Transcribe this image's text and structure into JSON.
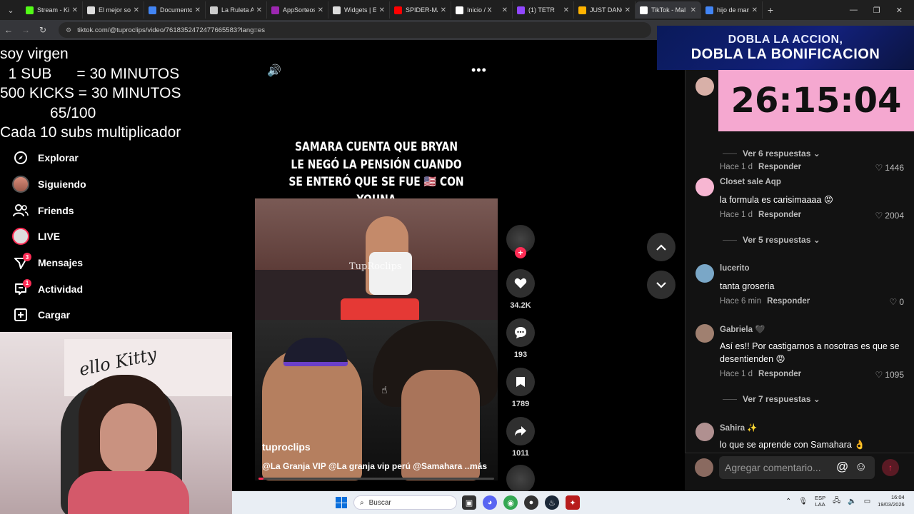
{
  "browser": {
    "tabs": [
      {
        "title": "Stream - Kick",
        "color": "#53fc18"
      },
      {
        "title": "El mejor soft",
        "color": "#dddddd"
      },
      {
        "title": "Documento",
        "color": "#4285f4"
      },
      {
        "title": "La Ruleta Ale",
        "color": "#cccccc"
      },
      {
        "title": "AppSorteos",
        "color": "#9c27b0"
      },
      {
        "title": "Widgets | E",
        "color": "#dddddd"
      },
      {
        "title": "SPIDER-MAN",
        "color": "#ff0000"
      },
      {
        "title": "Inicio / X",
        "color": "#ffffff"
      },
      {
        "title": "(1) TETR",
        "color": "#9147ff"
      },
      {
        "title": "JUST DANCE",
        "color": "#ffb300"
      },
      {
        "title": "TikTok - Mal",
        "color": "#ffffff"
      },
      {
        "title": "hijo de mam",
        "color": "#4285f4"
      }
    ],
    "url": "tiktok.com/@tuproclips/video/7618352472477665583?lang=es"
  },
  "overlay": {
    "lines": [
      "soy virgen",
      "  1 SUB      = 30 MINUTOS",
      "500 KICKS = 30 MINUTOS",
      "            65/100",
      "Cada 10 subs multiplicador"
    ]
  },
  "sidebar": {
    "items": [
      {
        "label": "Explorar",
        "icon": "compass-icon",
        "badge": ""
      },
      {
        "label": "Siguiendo",
        "icon": "avatar-icon",
        "badge": ""
      },
      {
        "label": "Friends",
        "icon": "friends-icon",
        "badge": ""
      },
      {
        "label": "LIVE",
        "icon": "live-icon",
        "badge": ""
      },
      {
        "label": "Mensajes",
        "icon": "send-icon",
        "badge": "3"
      },
      {
        "label": "Actividad",
        "icon": "inbox-icon",
        "badge": "1"
      },
      {
        "label": "Cargar",
        "icon": "plus-square-icon",
        "badge": ""
      }
    ]
  },
  "video": {
    "caption_lines": [
      "SAMARA CUENTA QUE BRYAN",
      "LE NEGÓ LA PENSIÓN  CUANDO",
      "SE ENTERÓ QUE SE FUE 🇺🇸 CON YOUNA"
    ],
    "watermark": "TupRoclips",
    "username": "tuproclips",
    "description": "@La Granja VIP @La granja vip perú @Samahara ...",
    "more_label": "más",
    "progress": 0.02
  },
  "actions": {
    "likes": "34.2K",
    "comments": "193",
    "saves": "1789",
    "shares": "1011"
  },
  "stream": {
    "banner_line1": "DOBLA LA ACCION,",
    "banner_line2": "DOBLA LA BONIFICACION",
    "timer": "26:15:04"
  },
  "comments": {
    "items": [
      {
        "name": "Closet sale Aqp",
        "text": "la formula es carisimaaaa 😡",
        "time": "Hace 1 d",
        "reply": "Responder",
        "likes": "2004",
        "replies": "Ver 5 respuestas",
        "avatar_color": "#f7b6d2"
      },
      {
        "name": "lucerito",
        "text": "tanta groseria",
        "time": "Hace 6 min",
        "reply": "Responder",
        "likes": "0",
        "replies": "",
        "avatar_color": "#7aa7c7"
      },
      {
        "name": "Gabriela 🖤",
        "text": "Así es!! Por castigarnos a nosotras es que se desentienden 😡",
        "time": "Hace 1 d",
        "reply": "Responder",
        "likes": "1095",
        "replies": "Ver 7 respuestas",
        "avatar_color": "#a08070"
      },
      {
        "name": "Sahira ✨",
        "text": "lo que se aprende con Samahara 👌",
        "time": "",
        "reply": "",
        "likes": "",
        "replies": "",
        "avatar_color": "#b09090"
      }
    ],
    "top_partial": {
      "time": "Hace 1 d",
      "reply": "Responder",
      "likes": "1446",
      "replies": "Ver 6 respuestas"
    },
    "input_placeholder": "Agregar comentario..."
  },
  "taskbar": {
    "search_placeholder": "Buscar",
    "lang_line1": "ESP",
    "lang_line2": "LAA",
    "time": "16:04",
    "date": "19/03/2026"
  }
}
